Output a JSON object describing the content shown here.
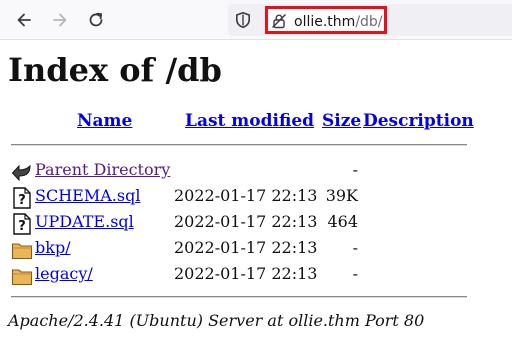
{
  "browser": {
    "back_icon": "arrow-left-icon",
    "forward_icon": "arrow-right-icon",
    "reload_icon": "reload-icon",
    "shield_icon": "tracking-protection-shield-icon",
    "lock_icon": "insecure-lock-icon",
    "url_host": "ollie.thm",
    "url_path": "/db/",
    "highlight_color": "#e8101a"
  },
  "page": {
    "title": "Index of /db",
    "columns": {
      "name": "Name",
      "last_modified": "Last modified",
      "size": "Size",
      "description": "Description"
    },
    "rows": [
      {
        "icon": "back-arrow-icon",
        "name": "Parent Directory",
        "date": "",
        "size": "-",
        "visited": true
      },
      {
        "icon": "unknown-file-icon",
        "name": "SCHEMA.sql",
        "date": "2022-01-17 22:13",
        "size": "39K",
        "visited": false
      },
      {
        "icon": "unknown-file-icon",
        "name": "UPDATE.sql",
        "date": "2022-01-17 22:13",
        "size": "464",
        "visited": false
      },
      {
        "icon": "folder-icon",
        "name": "bkp/",
        "date": "2022-01-17 22:13",
        "size": "-",
        "visited": false
      },
      {
        "icon": "folder-icon",
        "name": "legacy/",
        "date": "2022-01-17 22:13",
        "size": "-",
        "visited": false
      }
    ],
    "footer": "Apache/2.4.41 (Ubuntu) Server at ollie.thm Port 80"
  }
}
